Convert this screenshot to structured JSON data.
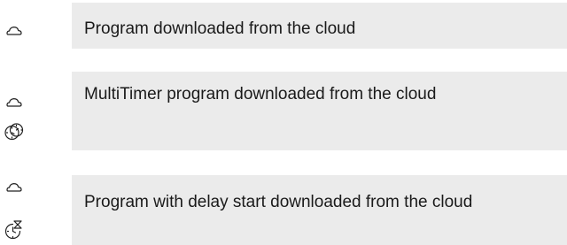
{
  "legend": {
    "rows": [
      {
        "icons": [
          "cloud-icon"
        ],
        "description": "Program downloaded from the cloud"
      },
      {
        "icons": [
          "cloud-icon",
          "multitimer-icon"
        ],
        "description": "MultiTimer program downloaded from the cloud"
      },
      {
        "icons": [
          "cloud-icon",
          "delay-start-icon"
        ],
        "description": "Program with delay start downloaded from the cloud"
      }
    ]
  },
  "colors": {
    "box_background": "#ebebeb",
    "text": "#1a1a1a",
    "icon_stroke": "#222222"
  }
}
